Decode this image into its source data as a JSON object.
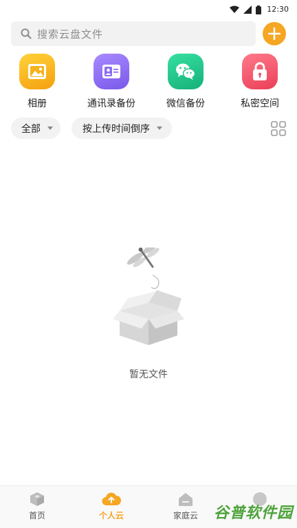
{
  "status_bar": {
    "time": "12:30"
  },
  "search": {
    "placeholder": "搜索云盘文件"
  },
  "quick_actions": [
    {
      "label": "相册",
      "icon": "photo-album-icon",
      "color": "#f7b21b"
    },
    {
      "label": "通讯录备份",
      "icon": "contacts-backup-icon",
      "color": "#8b6cf2"
    },
    {
      "label": "微信备份",
      "icon": "wechat-backup-icon",
      "color": "#21c48c"
    },
    {
      "label": "私密空间",
      "icon": "private-space-lock-icon",
      "color": "#f0566a"
    }
  ],
  "filters": {
    "type_filter": "全部",
    "sort_order": "按上传时间倒序"
  },
  "empty_state": {
    "message": "暂无文件"
  },
  "bottom_nav": {
    "items": [
      {
        "label": "首页",
        "icon": "home-cube-icon",
        "active": false
      },
      {
        "label": "个人云",
        "icon": "personal-cloud-upload-icon",
        "active": true
      },
      {
        "label": "家庭云",
        "icon": "family-cloud-house-icon",
        "active": false
      },
      {
        "label": "",
        "icon": "profile-icon",
        "active": false
      }
    ]
  },
  "watermark": {
    "text": "谷普软件园"
  },
  "colors": {
    "accent": "#f5a623",
    "chip_bg": "#f2f2f2",
    "watermark": "#4da33a"
  }
}
